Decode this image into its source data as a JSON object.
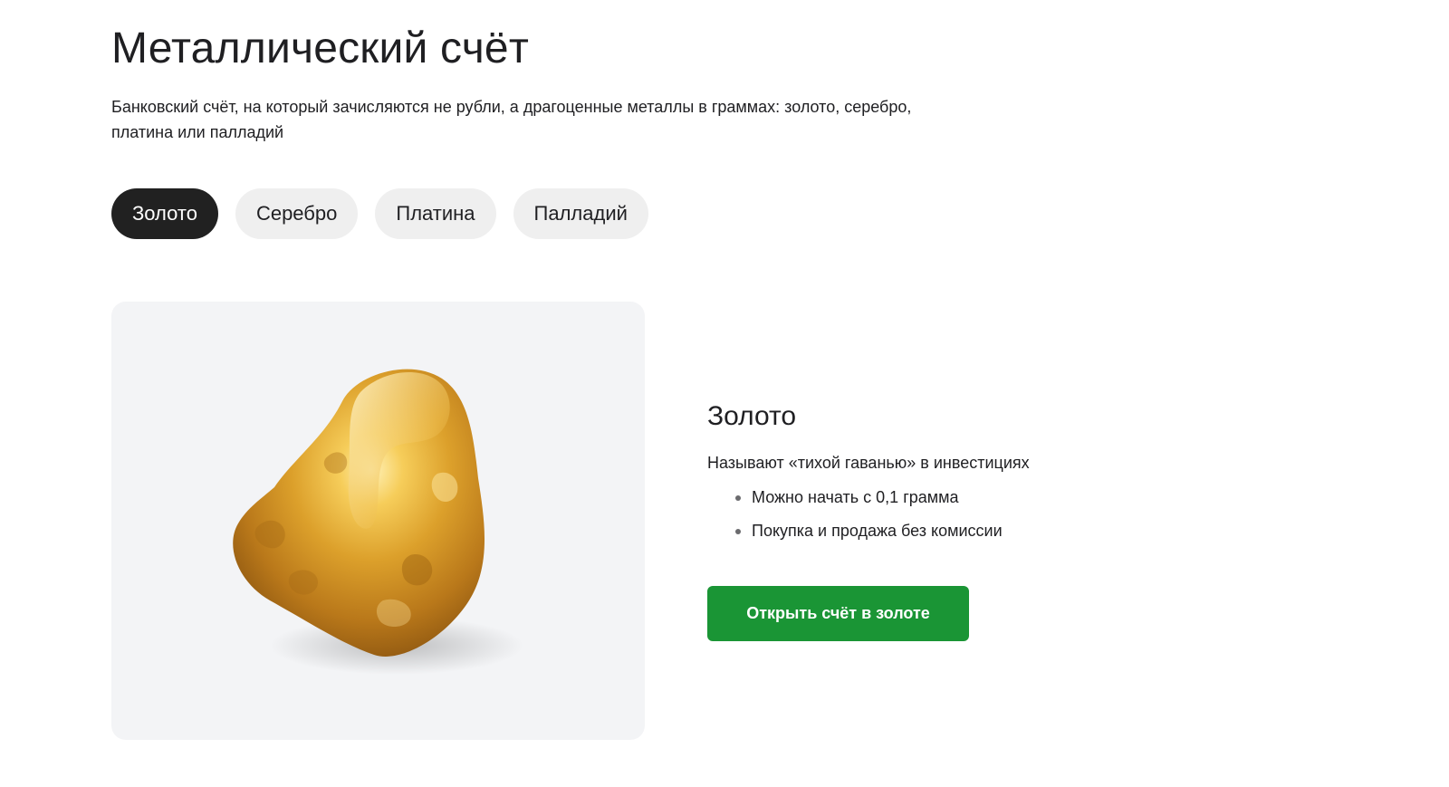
{
  "page": {
    "title": "Металлический счёт",
    "subtitle": "Банковский счёт, на который зачисляются не рубли, а драгоценные  металлы в граммах: золото, серебро, платина или палладий"
  },
  "tabs": [
    {
      "label": "Золото",
      "active": true
    },
    {
      "label": "Серебро",
      "active": false
    },
    {
      "label": "Платина",
      "active": false
    },
    {
      "label": "Палладий",
      "active": false
    }
  ],
  "product": {
    "image_icon": "gold-nugget",
    "title": "Золото",
    "description": "Называют «тихой гаванью» в инвестициях",
    "features": [
      "Можно начать с 0,1 грамма",
      "Покупка и продажа без комиссии"
    ],
    "cta_label": "Открыть счёт в золоте"
  },
  "colors": {
    "active_tab": "#212121",
    "inactive_tab": "#efefef",
    "cta": "#1a9535",
    "card_bg": "#f3f4f6",
    "gold": "#d9a22e"
  }
}
